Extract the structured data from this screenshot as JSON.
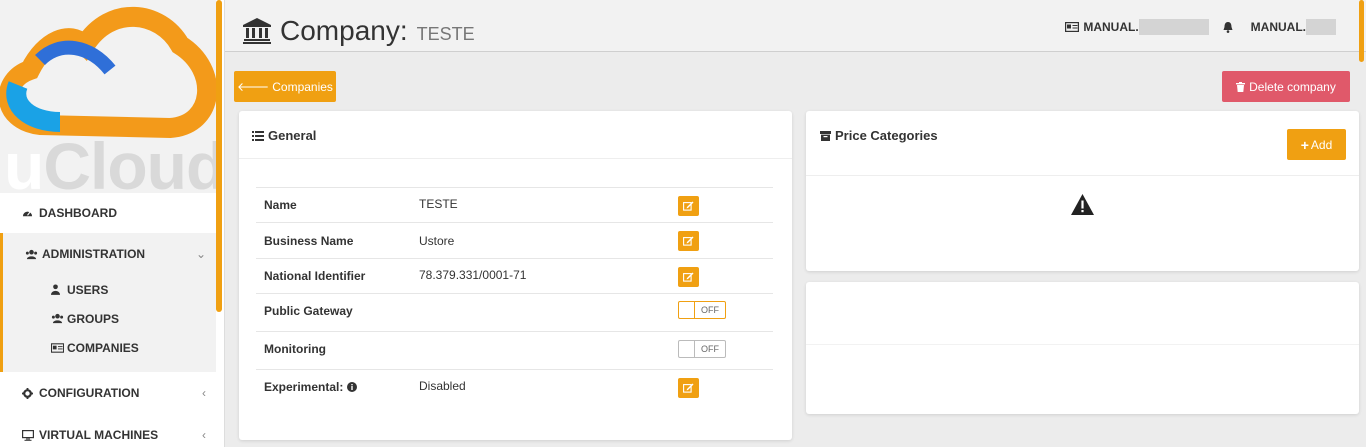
{
  "brand": {
    "logo_text_u": "u",
    "logo_text_rest": "Cloud",
    "accent": "#f0a012",
    "danger": "#e0596a"
  },
  "sidebar": {
    "dashboard": "DASHBOARD",
    "administration": "ADMINISTRATION",
    "sub_items": [
      "USERS",
      "GROUPS",
      "COMPANIES"
    ],
    "configuration": "CONFIGURATION",
    "virtual_machines": "VIRTUAL MACHINES"
  },
  "header": {
    "title": "Company:",
    "subtitle": "TESTE",
    "user_left": "MANUAL.",
    "user_right": "MANUAL."
  },
  "actions": {
    "back": "Companies",
    "delete": "Delete company"
  },
  "general": {
    "title": "General",
    "rows": [
      {
        "label": "Name",
        "value": "TESTE"
      },
      {
        "label": "Business Name",
        "value": "Ustore"
      },
      {
        "label": "National Identifier",
        "value": "78.379.331/0001-71"
      },
      {
        "label": "Public Gateway",
        "value": "",
        "toggle": "OFF"
      },
      {
        "label": "Monitoring",
        "value": "",
        "toggle": "OFF"
      },
      {
        "label": "Experimental:",
        "value": "Disabled"
      }
    ]
  },
  "price_categories": {
    "title": "Price Categories",
    "add_label": "Add"
  }
}
